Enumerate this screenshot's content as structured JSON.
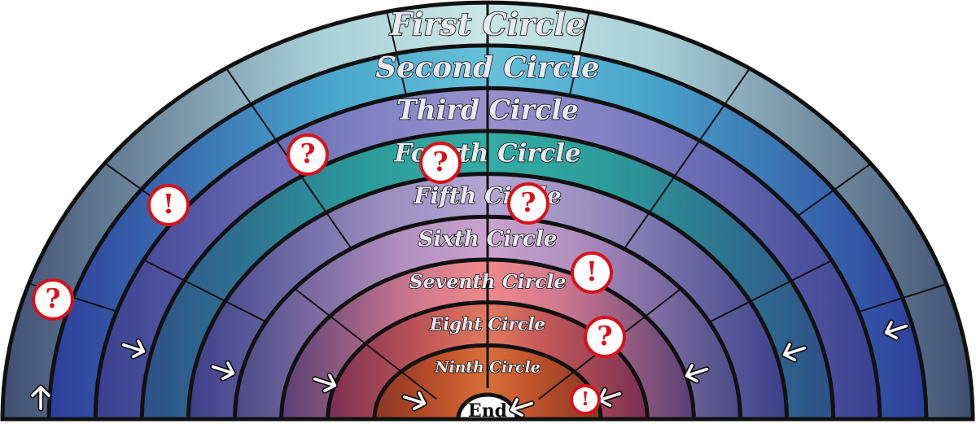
{
  "rings": [
    {
      "label": "First Circle",
      "color_outer": "#3f4f72",
      "color_mid": "#a9d0d6",
      "color_center": "#c9e6e6"
    },
    {
      "label": "Second Circle",
      "color_outer": "#2d3d9a",
      "color_mid": "#4aa8cc",
      "color_center": "#66c0da"
    },
    {
      "label": "Third Circle",
      "color_outer": "#3a3f90",
      "color_mid": "#7d7fc2",
      "color_center": "#9a90cc"
    },
    {
      "label": "Fourth Circle",
      "color_outer": "#2f4f88",
      "color_mid": "#2c9c9a",
      "color_center": "#34aca4"
    },
    {
      "label": "Fifth Circle",
      "color_outer": "#3c3f88",
      "color_mid": "#9b8fc0",
      "color_center": "#b2a6d2"
    },
    {
      "label": "Sixth Circle",
      "color_outer": "#4a4a86",
      "color_mid": "#b28fc0",
      "color_center": "#c9a3cc"
    },
    {
      "label": "Seventh Circle",
      "color_outer": "#5a3f74",
      "color_mid": "#d07a90",
      "color_center": "#f0888a"
    },
    {
      "label": "Eight Circle",
      "color_outer": "#7a2f52",
      "color_mid": "#c65a58",
      "color_center": "#e07a60"
    },
    {
      "label": "Ninth Circle",
      "color_outer": "#8a3424",
      "color_mid": "#c3562c",
      "color_center": "#d8703a"
    }
  ],
  "end": {
    "label": "End"
  },
  "tokens": [
    {
      "symbol": "?"
    },
    {
      "symbol": "!"
    },
    {
      "symbol": "?"
    },
    {
      "symbol": "?"
    },
    {
      "symbol": "?"
    },
    {
      "symbol": "!"
    },
    {
      "symbol": "?"
    },
    {
      "symbol": "!"
    }
  ],
  "arrows": [
    {
      "direction": "up"
    },
    {
      "direction": "right"
    },
    {
      "direction": "right"
    },
    {
      "direction": "right"
    },
    {
      "direction": "right"
    },
    {
      "direction": "left"
    },
    {
      "direction": "left"
    },
    {
      "direction": "left"
    },
    {
      "direction": "left"
    },
    {
      "direction": "left"
    }
  ]
}
